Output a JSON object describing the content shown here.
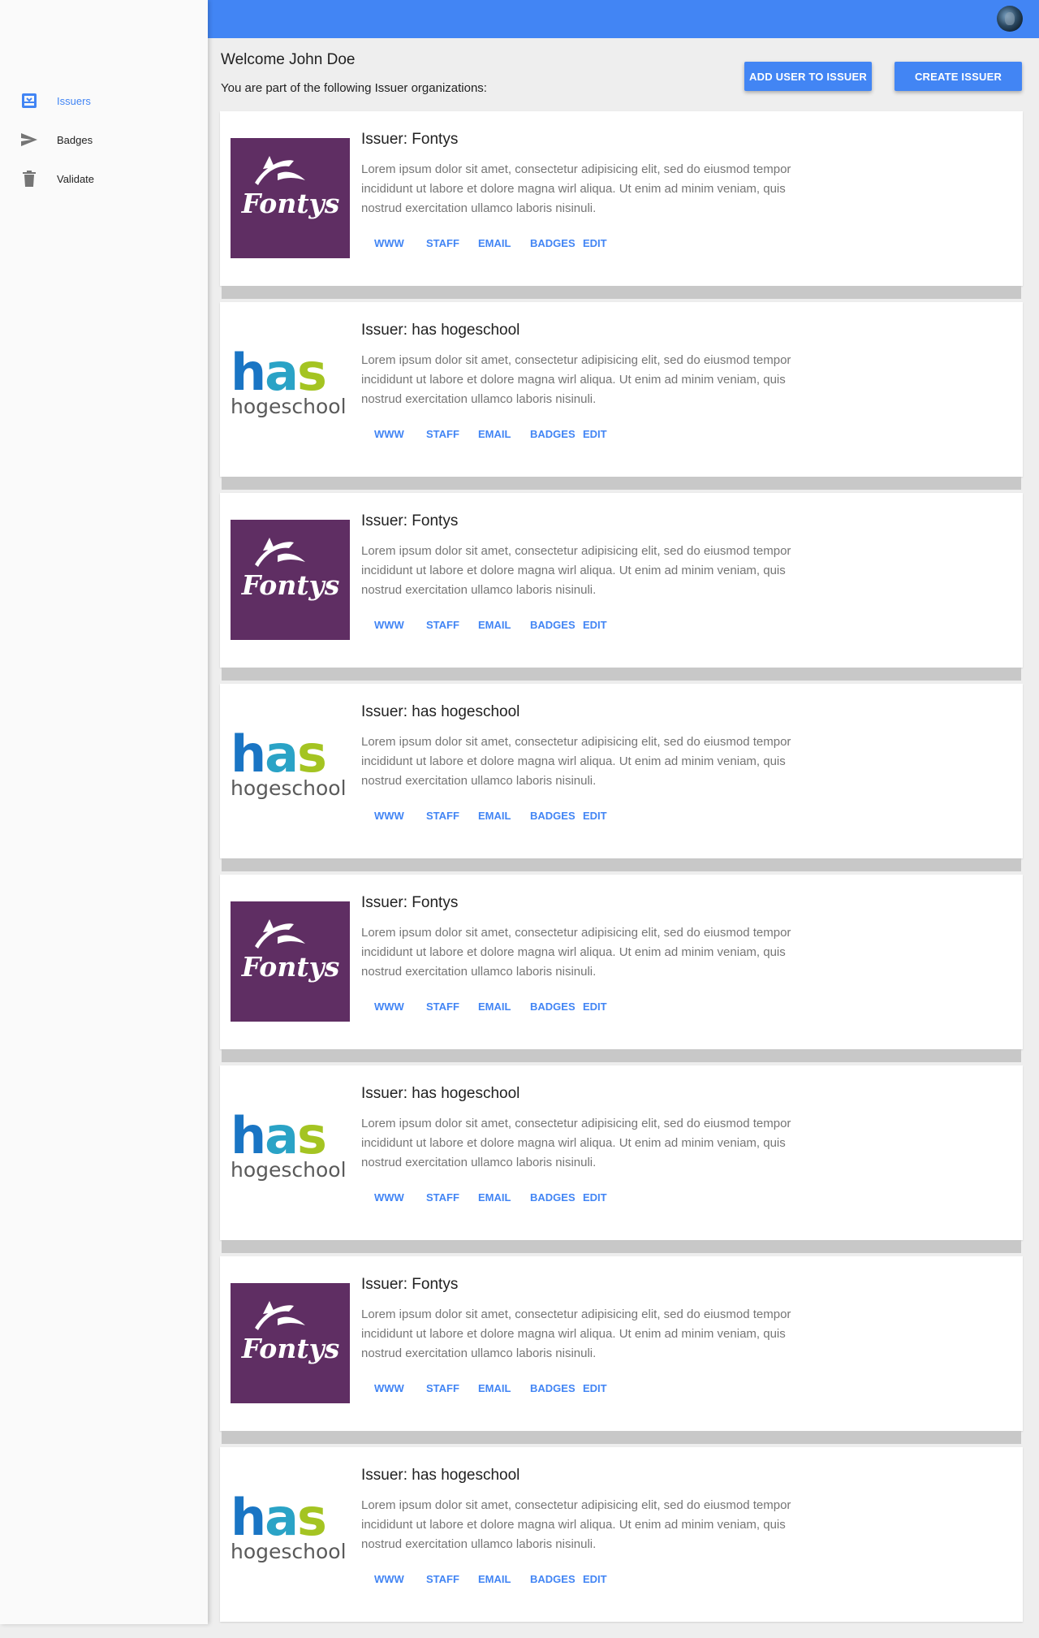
{
  "sidebar": {
    "items": [
      {
        "label": "Issuers",
        "icon": "inbox-icon",
        "active": true
      },
      {
        "label": "Badges",
        "icon": "send-icon",
        "active": false
      },
      {
        "label": "Validate",
        "icon": "trash-icon",
        "active": false
      }
    ]
  },
  "header": {
    "avatar": "user-avatar"
  },
  "main": {
    "welcome": "Welcome John Doe",
    "subtitle": "You are part of the following Issuer organizations:",
    "add_user_button": "ADD USER TO ISSUER",
    "create_issuer_button": "CREATE ISSUER"
  },
  "colors": {
    "accent": "#4285f4",
    "fontys": "#5f2e63",
    "has_blue": "#1a75c4",
    "has_green": "#a4c422"
  },
  "actions": [
    "WWW",
    "STAFF",
    "EMAIL",
    "BADGES",
    "EDIT"
  ],
  "issuers": [
    {
      "title": "Issuer: Fontys",
      "logo": "fontys",
      "logo_text": "Fontys",
      "description": "Lorem ipsum dolor sit amet, consectetur adipisicing elit, sed do eiusmod tempor incididunt ut labore et dolore magna wirl aliqua. Ut enim ad minim veniam, quis nostrud exercitation ullamco laboris nisinuli."
    },
    {
      "title": "Issuer: has hogeschool",
      "logo": "has",
      "logo_text": "has",
      "logo_subtext": "hogeschool",
      "description": "Lorem ipsum dolor sit amet, consectetur adipisicing elit, sed do eiusmod tempor incididunt ut labore et dolore magna wirl aliqua. Ut enim ad minim veniam, quis nostrud exercitation ullamco laboris nisinuli."
    },
    {
      "title": "Issuer: Fontys",
      "logo": "fontys",
      "logo_text": "Fontys",
      "description": "Lorem ipsum dolor sit amet, consectetur adipisicing elit, sed do eiusmod tempor incididunt ut labore et dolore magna wirl aliqua. Ut enim ad minim veniam, quis nostrud exercitation ullamco laboris nisinuli."
    },
    {
      "title": "Issuer: has hogeschool",
      "logo": "has",
      "logo_text": "has",
      "logo_subtext": "hogeschool",
      "description": "Lorem ipsum dolor sit amet, consectetur adipisicing elit, sed do eiusmod tempor incididunt ut labore et dolore magna wirl aliqua. Ut enim ad minim veniam, quis nostrud exercitation ullamco laboris nisinuli."
    },
    {
      "title": "Issuer: Fontys",
      "logo": "fontys",
      "logo_text": "Fontys",
      "description": "Lorem ipsum dolor sit amet, consectetur adipisicing elit, sed do eiusmod tempor incididunt ut labore et dolore magna wirl aliqua. Ut enim ad minim veniam, quis nostrud exercitation ullamco laboris nisinuli."
    },
    {
      "title": "Issuer: has hogeschool",
      "logo": "has",
      "logo_text": "has",
      "logo_subtext": "hogeschool",
      "description": "Lorem ipsum dolor sit amet, consectetur adipisicing elit, sed do eiusmod tempor incididunt ut labore et dolore magna wirl aliqua. Ut enim ad minim veniam, quis nostrud exercitation ullamco laboris nisinuli."
    },
    {
      "title": "Issuer: Fontys",
      "logo": "fontys",
      "logo_text": "Fontys",
      "description": "Lorem ipsum dolor sit amet, consectetur adipisicing elit, sed do eiusmod tempor incididunt ut labore et dolore magna wirl aliqua. Ut enim ad minim veniam, quis nostrud exercitation ullamco laboris nisinuli."
    },
    {
      "title": "Issuer: has hogeschool",
      "logo": "has",
      "logo_text": "has",
      "logo_subtext": "hogeschool",
      "description": "Lorem ipsum dolor sit amet, consectetur adipisicing elit, sed do eiusmod tempor incididunt ut labore et dolore magna wirl aliqua. Ut enim ad minim veniam, quis nostrud exercitation ullamco laboris nisinuli."
    }
  ]
}
